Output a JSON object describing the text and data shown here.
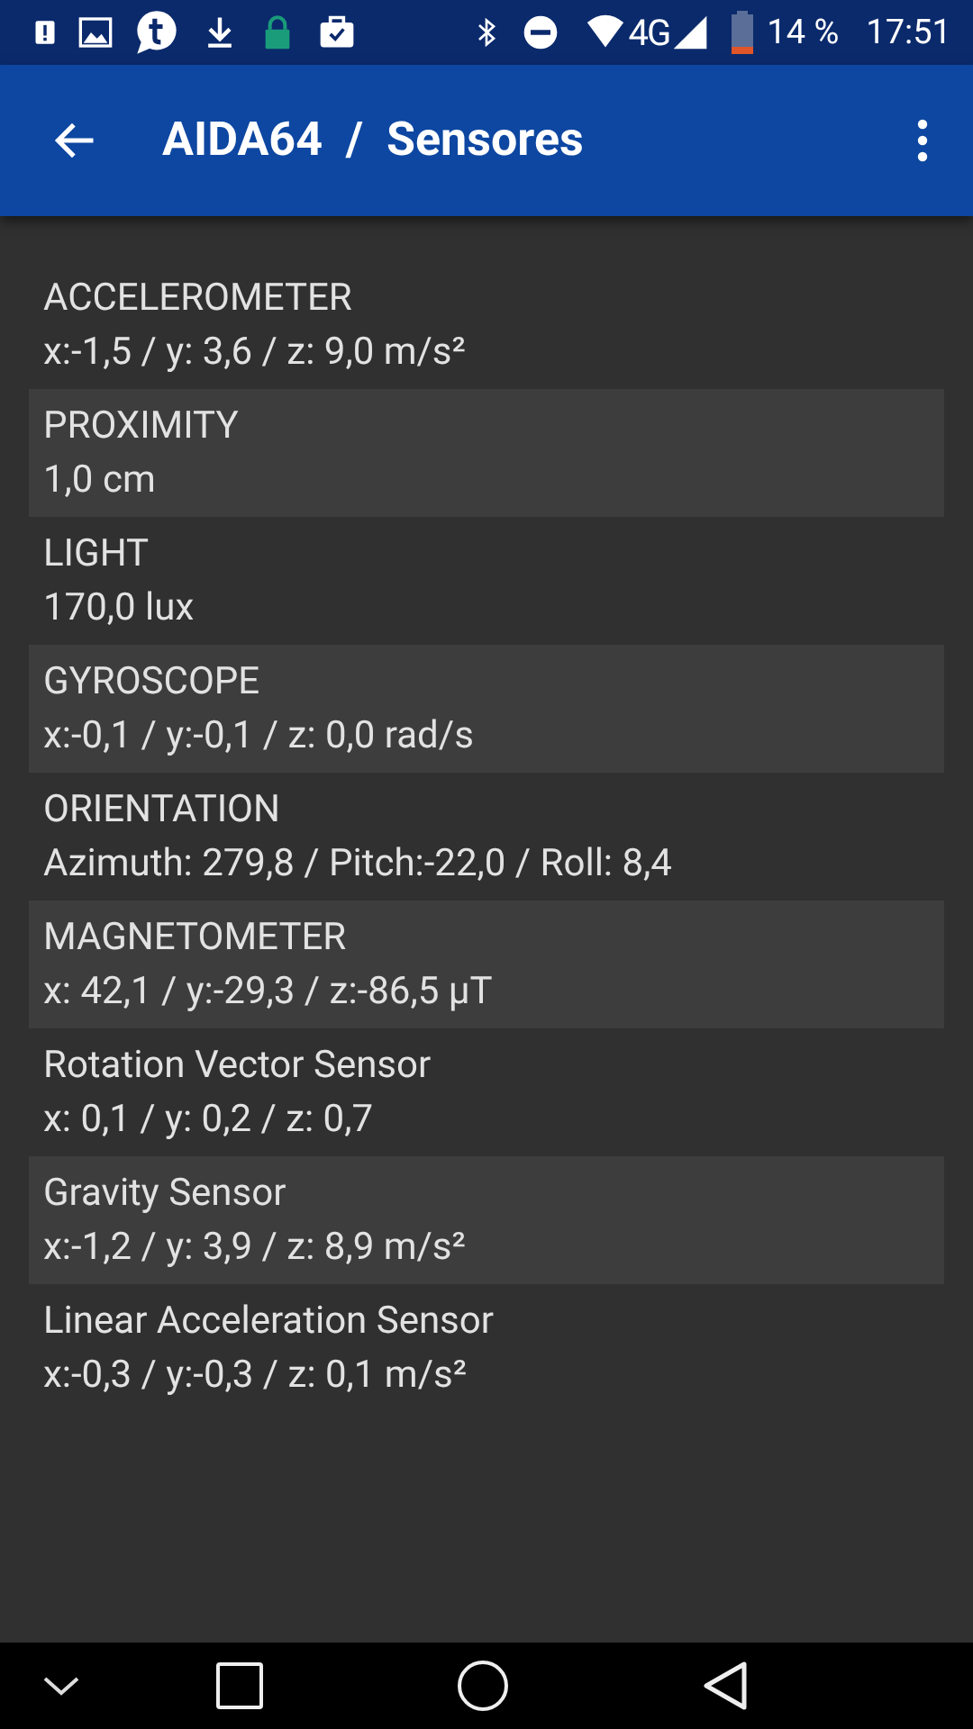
{
  "status_bar": {
    "network": "4G",
    "battery": "14 %",
    "time": "17:51"
  },
  "app_bar": {
    "title": "AIDA64  /  Sensores"
  },
  "sensors": [
    {
      "name": "ACCELEROMETER",
      "value": "x:-1,5 / y: 3,6 / z: 9,0 m/s²"
    },
    {
      "name": "PROXIMITY",
      "value": "1,0 cm"
    },
    {
      "name": "LIGHT",
      "value": "170,0 lux"
    },
    {
      "name": "GYROSCOPE",
      "value": "x:-0,1 / y:-0,1 / z: 0,0 rad/s"
    },
    {
      "name": "ORIENTATION",
      "value": "Azimuth: 279,8 / Pitch:-22,0 / Roll: 8,4"
    },
    {
      "name": "MAGNETOMETER",
      "value": "x: 42,1 / y:-29,3 / z:-86,5 µT"
    },
    {
      "name": "Rotation Vector Sensor",
      "value": "x: 0,1 / y: 0,2 / z: 0,7"
    },
    {
      "name": "Gravity Sensor",
      "value": "x:-1,2 / y: 3,9 / z: 8,9 m/s²"
    },
    {
      "name": "Linear Acceleration Sensor",
      "value": "x:-0,3 / y:-0,3 / z: 0,1 m/s²"
    }
  ]
}
